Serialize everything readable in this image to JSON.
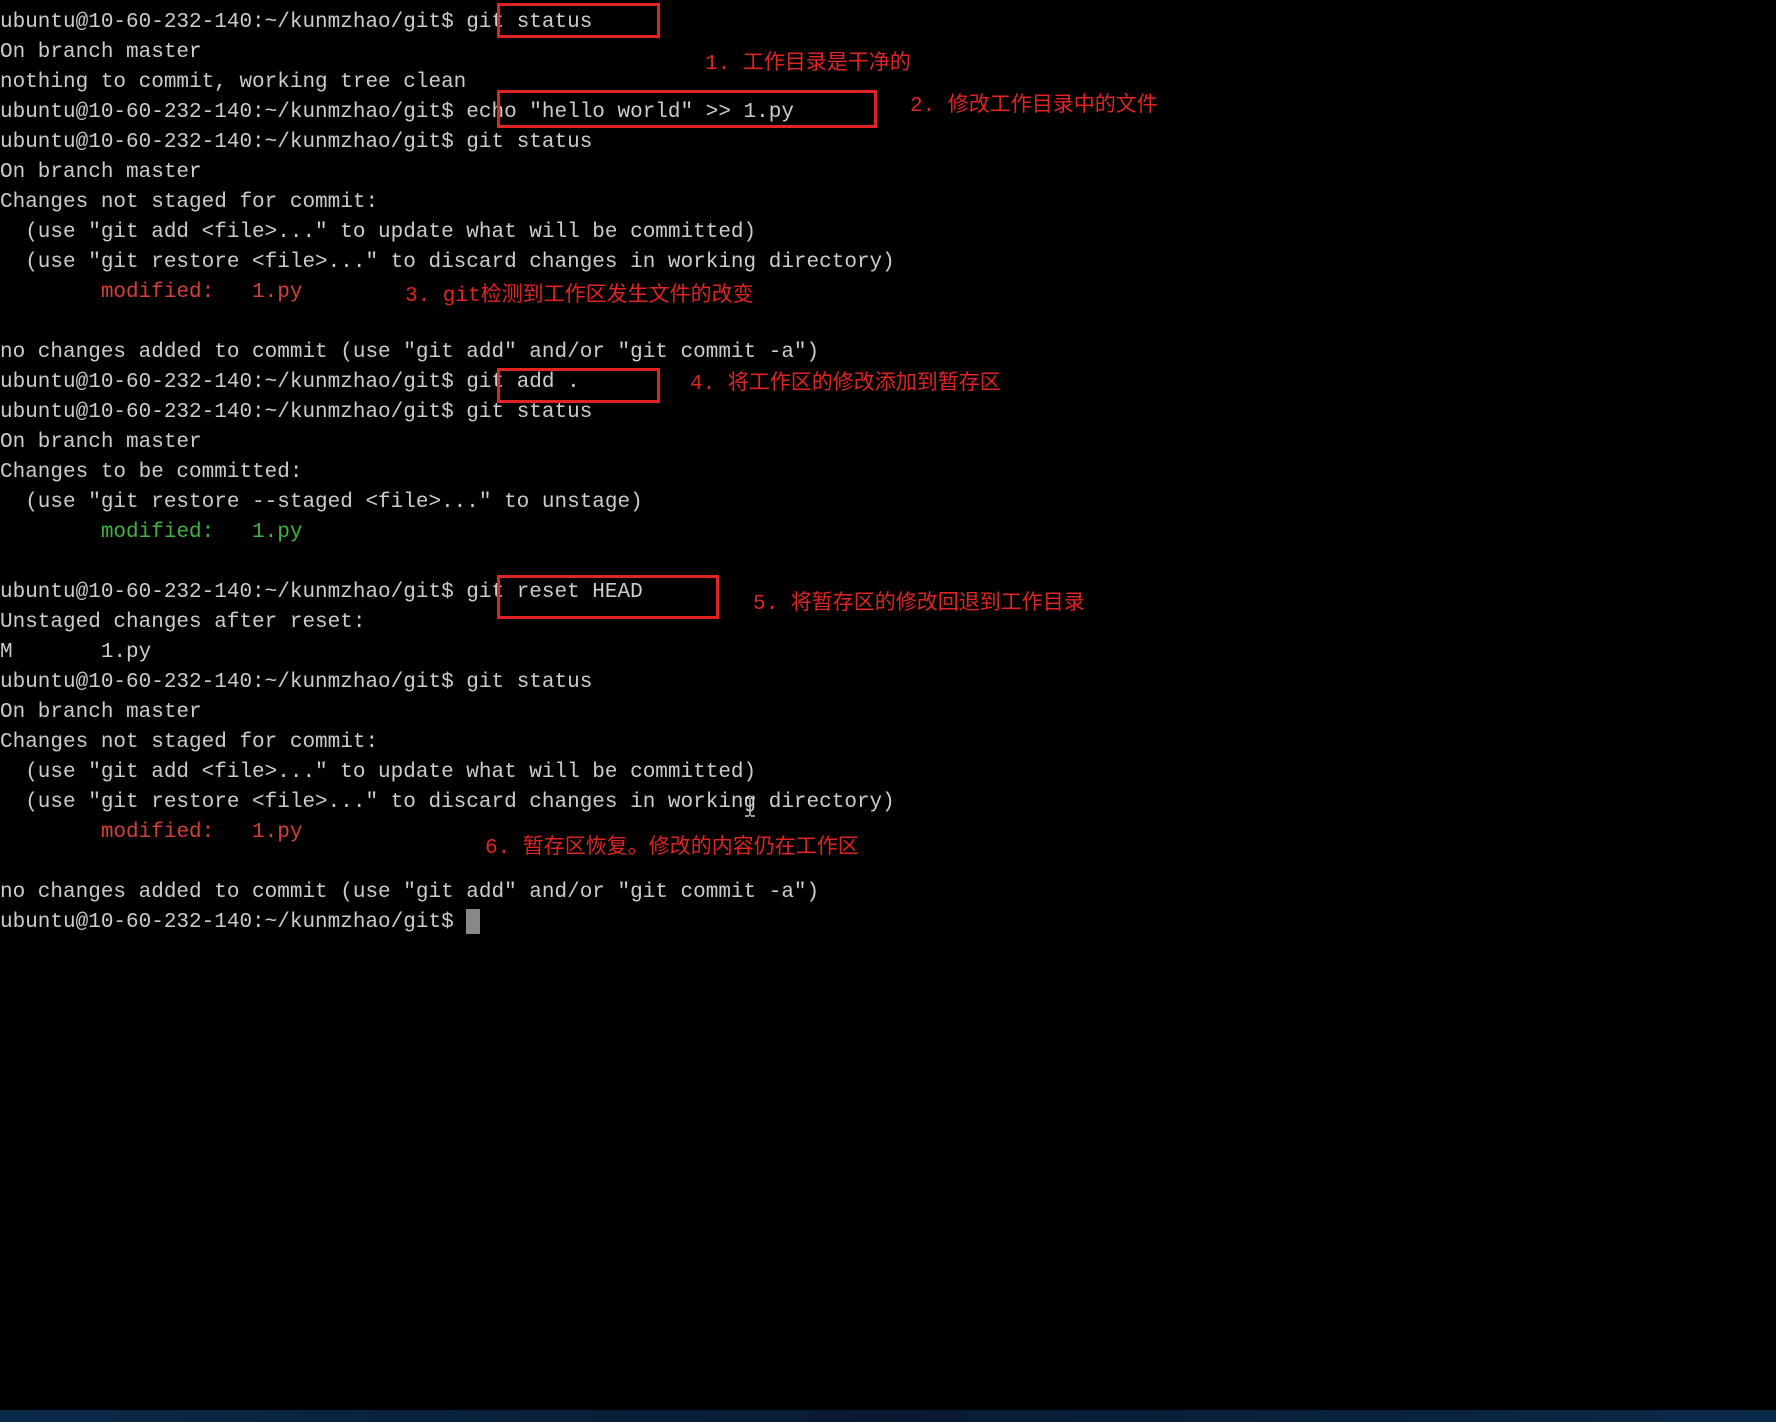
{
  "prompt": "ubuntu@10-60-232-140:~/kunmzhao/git$ ",
  "cmds": {
    "status": "git status",
    "echo": "echo \"hello world\" >> 1.py",
    "add": "git add .",
    "reset": "git reset HEAD"
  },
  "out": {
    "branch": "On branch master",
    "clean": "nothing to commit, working tree clean",
    "notstaged": "Changes not staged for commit:",
    "useadd": "  (use \"git add <file>...\" to update what will be committed)",
    "userestore": "  (use \"git restore <file>...\" to discard changes in working directory)",
    "modified_red_pad": "        ",
    "modified_red": "modified:   1.py",
    "nochanges": "no changes added to commit (use \"git add\" and/or \"git commit -a\")",
    "tobecommitted": "Changes to be committed:",
    "userestorestaged": "  (use \"git restore --staged <file>...\" to unstage)",
    "modified_green_pad": "        ",
    "modified_green": "modified:   1.py",
    "unstaged_after_reset": "Unstaged changes after reset:",
    "m_file": "M       1.py"
  },
  "annots": {
    "a1": "1. 工作目录是干净的",
    "a2": "2. 修改工作目录中的文件",
    "a3": "3. git检测到工作区发生文件的改变",
    "a4": "4. 将工作区的修改添加到暂存区",
    "a5": "5. 将暂存区的修改回退到工作目录",
    "a6": "6. 暂存区恢复。修改的内容仍在工作区"
  }
}
